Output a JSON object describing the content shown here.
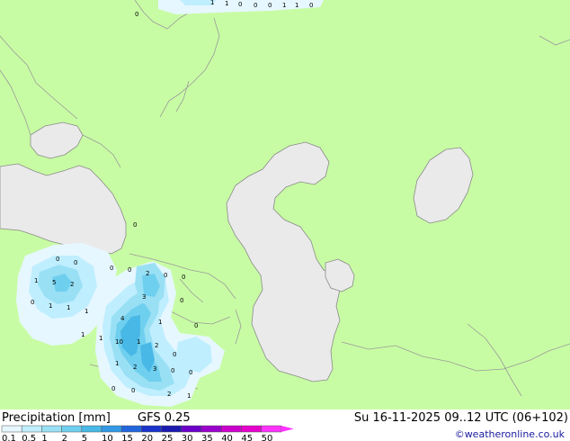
{
  "footer": {
    "title": "Precipitation [mm]",
    "model": "GFS 0.25",
    "valid_time": "Su 16-11-2025 09..12 UTC (06+102)",
    "credit": "©weatheronline.co.uk"
  },
  "legend": {
    "ticks": [
      "0.1",
      "0.5",
      "1",
      "2",
      "5",
      "10",
      "15",
      "20",
      "25",
      "30",
      "35",
      "40",
      "45",
      "50"
    ],
    "colors": [
      "#e6f7ff",
      "#bfeeff",
      "#99e0f5",
      "#6fcfee",
      "#48b8e6",
      "#3399e6",
      "#2266dd",
      "#1a33cc",
      "#1a1ab0",
      "#6a00c8",
      "#9900cc",
      "#cc00cc",
      "#e600cc",
      "#ff33ff"
    ]
  },
  "map_values": [
    {
      "text": "0"
    },
    {
      "text": "1"
    },
    {
      "text": "1"
    },
    {
      "text": "0"
    },
    {
      "text": "0"
    },
    {
      "text": "0"
    },
    {
      "text": "1"
    },
    {
      "text": "1"
    },
    {
      "text": "0"
    },
    {
      "text": "0"
    },
    {
      "text": "0"
    },
    {
      "text": "0"
    },
    {
      "text": "1"
    },
    {
      "text": "5"
    },
    {
      "text": "2"
    },
    {
      "text": "0"
    },
    {
      "text": "1"
    },
    {
      "text": "1"
    },
    {
      "text": "1"
    },
    {
      "text": "1"
    },
    {
      "text": "0"
    },
    {
      "text": "0"
    },
    {
      "text": "2"
    },
    {
      "text": "0"
    },
    {
      "text": "0"
    },
    {
      "text": "3"
    },
    {
      "text": "0"
    },
    {
      "text": "4"
    },
    {
      "text": "1"
    },
    {
      "text": "10"
    },
    {
      "text": "1"
    },
    {
      "text": "2"
    },
    {
      "text": "1"
    },
    {
      "text": "0"
    },
    {
      "text": "1"
    },
    {
      "text": "2"
    },
    {
      "text": "3"
    },
    {
      "text": "0"
    },
    {
      "text": "0"
    },
    {
      "text": "0"
    },
    {
      "text": "0"
    },
    {
      "text": "2"
    },
    {
      "text": "1"
    },
    {
      "text": "0"
    }
  ],
  "colors": {
    "land": "#c8fca4",
    "sea": "#eaeaea",
    "border": "#9a9a9a"
  }
}
